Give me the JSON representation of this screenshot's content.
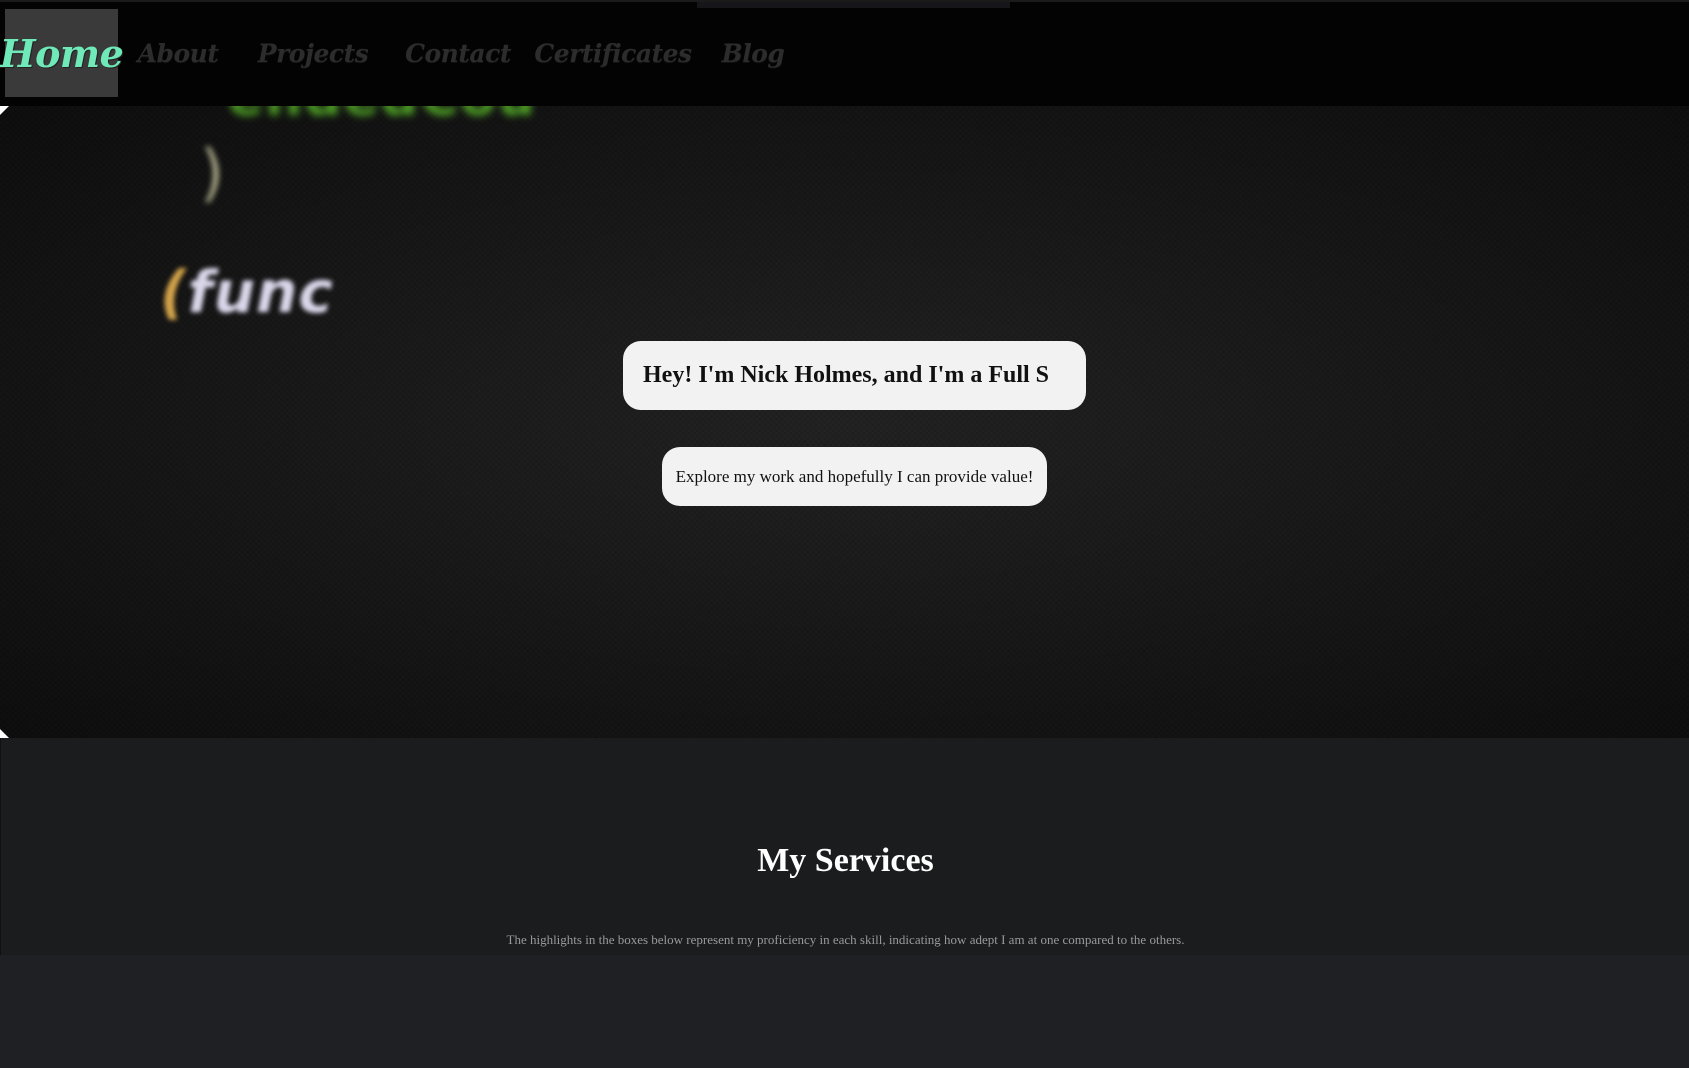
{
  "nav": {
    "items": [
      {
        "label": "Home",
        "active": true
      },
      {
        "label": "About",
        "active": false
      },
      {
        "label": "Projects",
        "active": false
      },
      {
        "label": "Contact",
        "active": false
      },
      {
        "label": "Certificates",
        "active": false
      },
      {
        "label": "Blog",
        "active": false
      }
    ]
  },
  "hero": {
    "code_line_1": "endedCou  ",
    "code_brace": ")",
    "code_func_paren": "(",
    "code_func_word": "func",
    "title": "Hey! I'm Nick Holmes, and I'm a Full S",
    "subtitle": "Explore my work and hopefully I can provide value!"
  },
  "services": {
    "title": "My Services",
    "description": "The highlights in the boxes below represent my proficiency in each skill, indicating how adept I am at one compared to the others."
  },
  "colors": {
    "accent": "#6fe9b8",
    "nav_background": "#030303",
    "page_background": "#1e1f22"
  }
}
